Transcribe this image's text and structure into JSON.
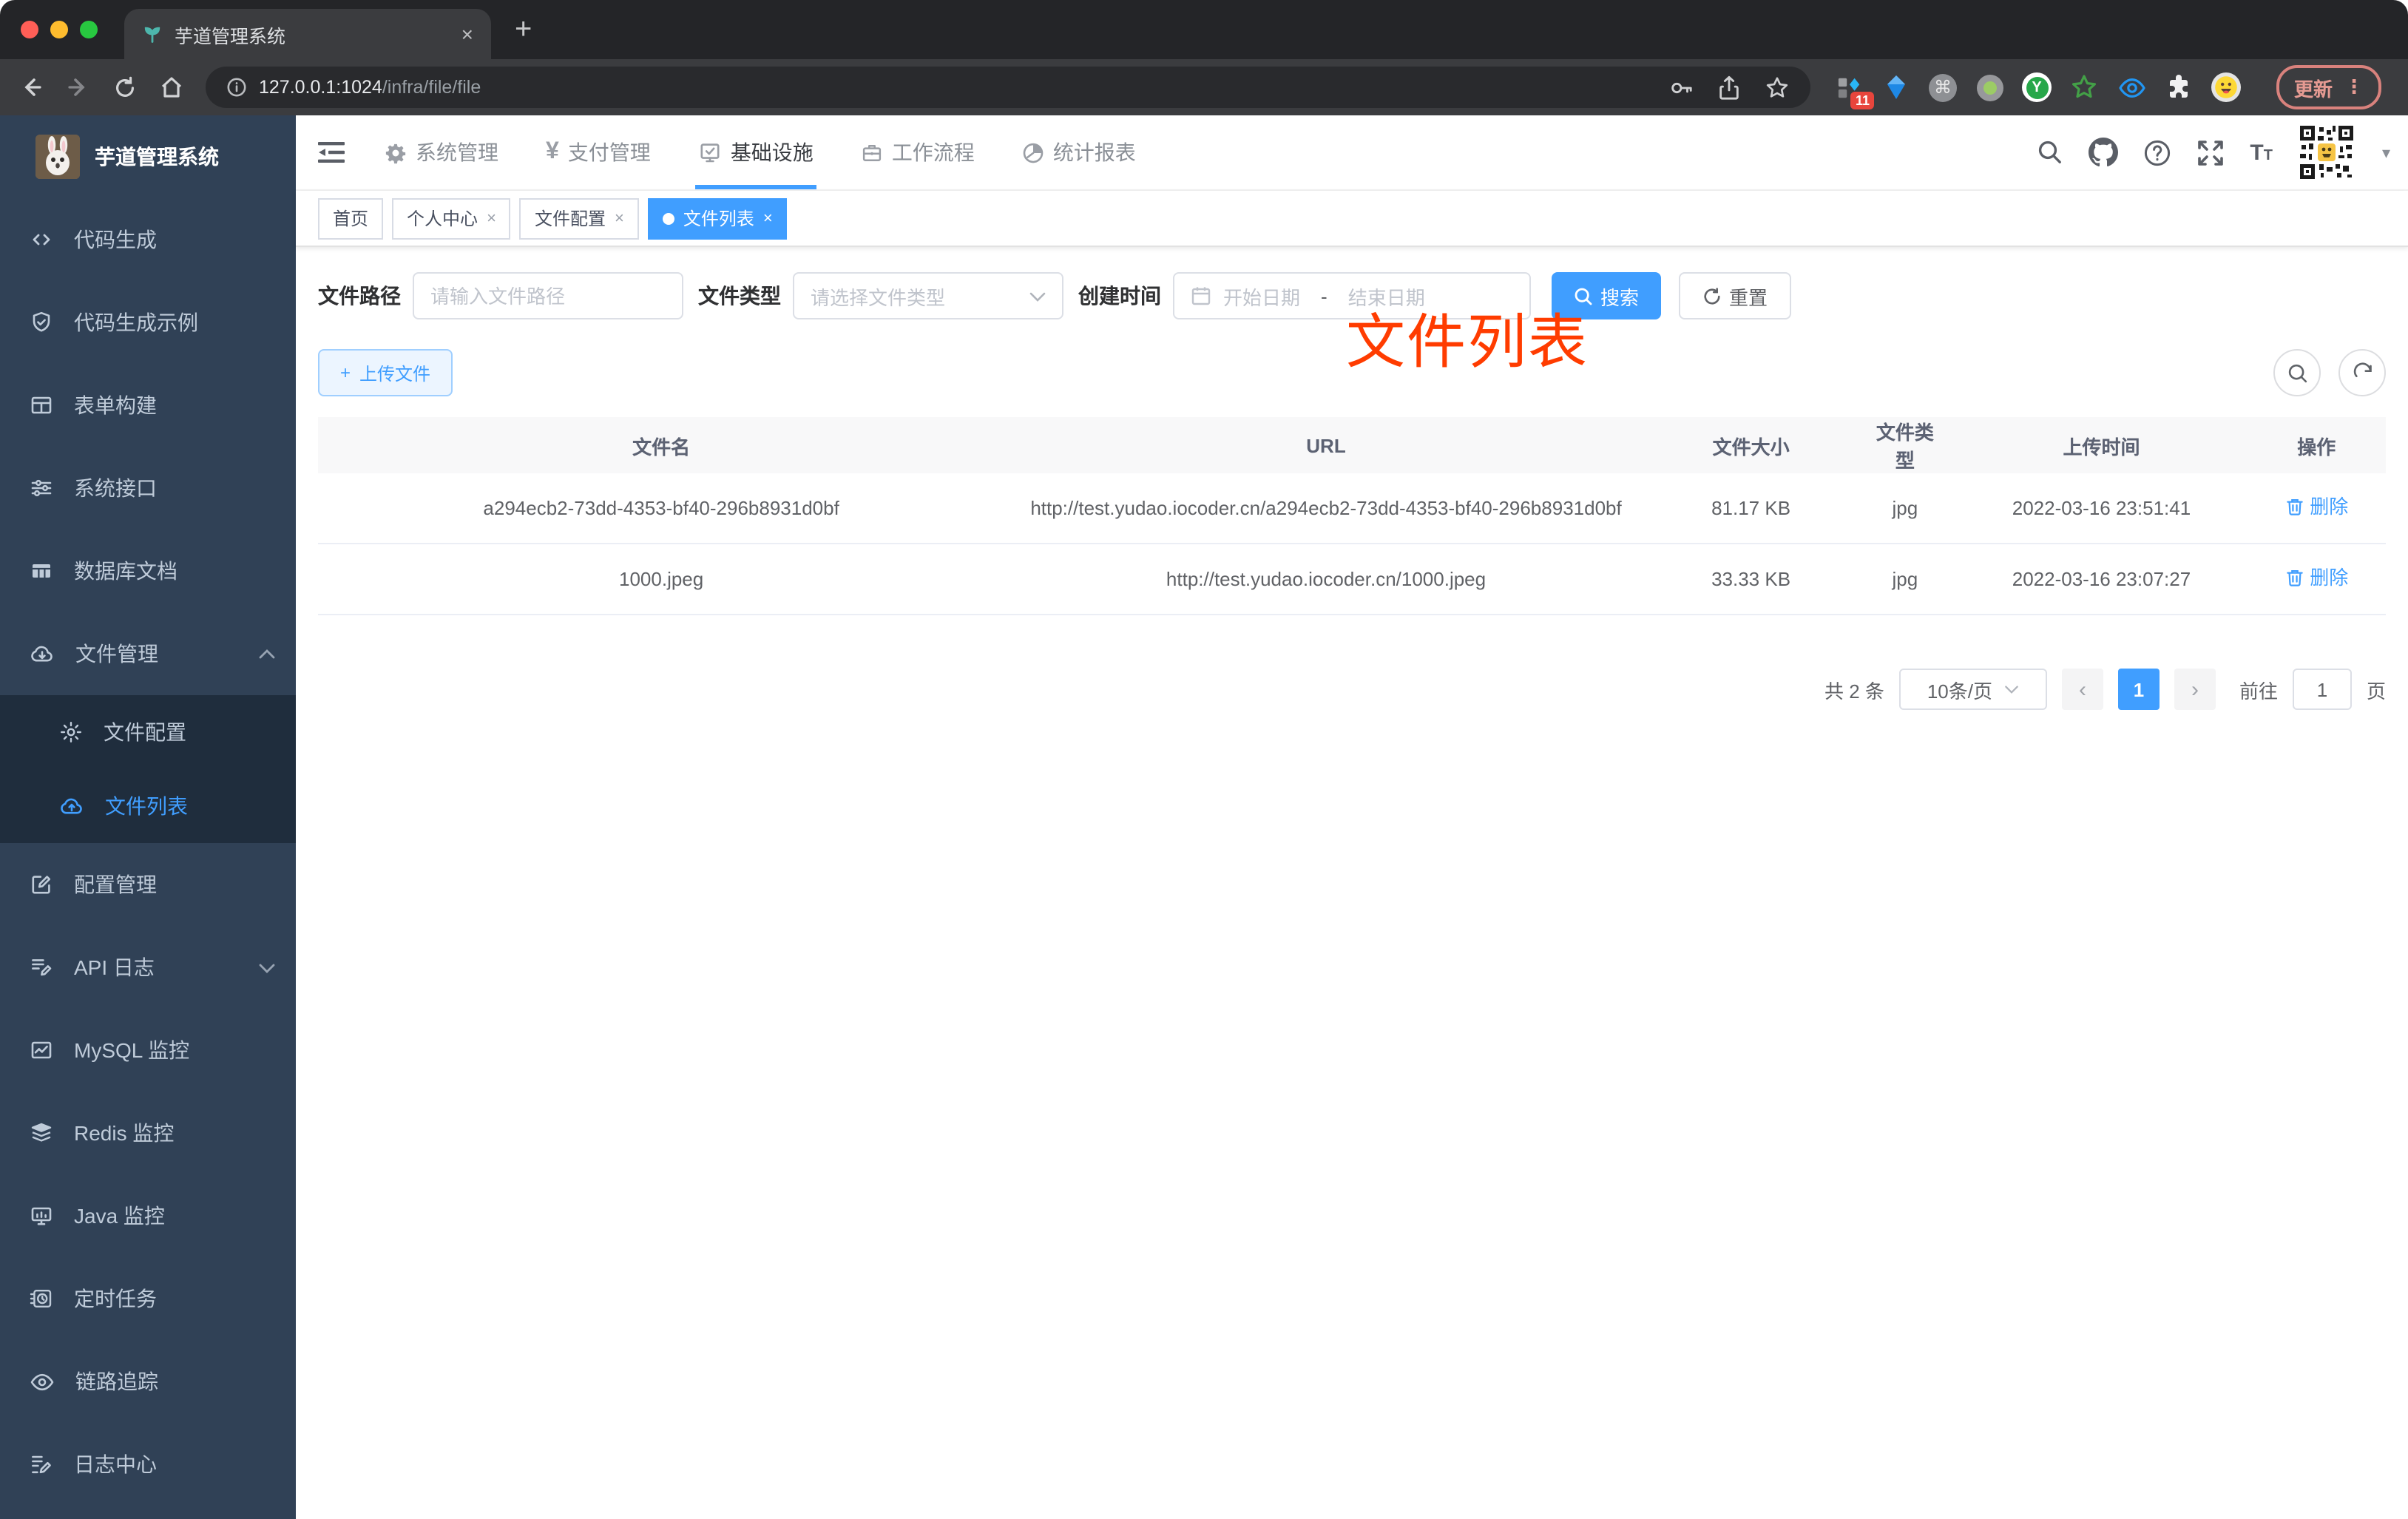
{
  "browser": {
    "tab_title": "芋道管理系统",
    "url_host": "127.0.0.1:1024",
    "url_path": "/infra/file/file",
    "extension_badge": "11",
    "update_label": "更新"
  },
  "glyphs": {
    "close": "×",
    "new_tab": "+",
    "command": "⌘",
    "yen": "¥",
    "kebab": "⋮",
    "caret_down": "▾",
    "prev": "‹",
    "next": "›",
    "plus": "+",
    "question": "?",
    "y_letter": "Y"
  },
  "sidebar": {
    "title": "芋道管理系统",
    "items": [
      {
        "label": "代码生成"
      },
      {
        "label": "代码生成示例"
      },
      {
        "label": "表单构建"
      },
      {
        "label": "系统接口"
      },
      {
        "label": "数据库文档"
      },
      {
        "label": "文件管理"
      },
      {
        "label": "文件配置"
      },
      {
        "label": "文件列表"
      },
      {
        "label": "配置管理"
      },
      {
        "label": "API 日志"
      },
      {
        "label": "MySQL 监控"
      },
      {
        "label": "Redis 监控"
      },
      {
        "label": "Java 监控"
      },
      {
        "label": "定时任务"
      },
      {
        "label": "链路追踪"
      },
      {
        "label": "日志中心"
      }
    ]
  },
  "topnav": {
    "items": [
      {
        "label": "系统管理"
      },
      {
        "label": "支付管理"
      },
      {
        "label": "基础设施"
      },
      {
        "label": "工作流程"
      },
      {
        "label": "统计报表"
      }
    ],
    "active": "基础设施"
  },
  "tabs": {
    "items": [
      {
        "label": "首页"
      },
      {
        "label": "个人中心"
      },
      {
        "label": "文件配置"
      },
      {
        "label": "文件列表"
      }
    ],
    "active": "文件列表"
  },
  "annotation": {
    "text": "文件列表",
    "color": "#ff3c00"
  },
  "filters": {
    "path_label": "文件路径",
    "path_placeholder": "请输入文件路径",
    "type_label": "文件类型",
    "type_placeholder": "请选择文件类型",
    "date_label": "创建时间",
    "date_start_placeholder": "开始日期",
    "date_separator": "-",
    "date_end_placeholder": "结束日期",
    "search_label": "搜索",
    "reset_label": "重置"
  },
  "actions": {
    "upload_label": "上传文件"
  },
  "table": {
    "headers": [
      "文件名",
      "URL",
      "文件大小",
      "文件类型",
      "上传时间",
      "操作"
    ],
    "rows": [
      {
        "name": "a294ecb2-73dd-4353-bf40-296b8931d0bf",
        "url": "http://test.yudao.iocoder.cn/a294ecb2-73dd-4353-bf40-296b8931d0bf",
        "size": "81.17 KB",
        "type": "jpg",
        "time": "2022-03-16 23:51:41",
        "action": "删除"
      },
      {
        "name": "1000.jpeg",
        "url": "http://test.yudao.iocoder.cn/1000.jpeg",
        "size": "33.33 KB",
        "type": "jpg",
        "time": "2022-03-16 23:07:27",
        "action": "删除"
      }
    ]
  },
  "pagination": {
    "total": "共 2 条",
    "page_size": "10条/页",
    "current_page": "1",
    "goto_label": "前往",
    "goto_value": "1",
    "page_unit": "页"
  },
  "colors": {
    "accent": "#409eff",
    "sidebar_bg": "#304156",
    "submenu_bg": "#1f2d3d",
    "annotation": "#ff3c00"
  }
}
